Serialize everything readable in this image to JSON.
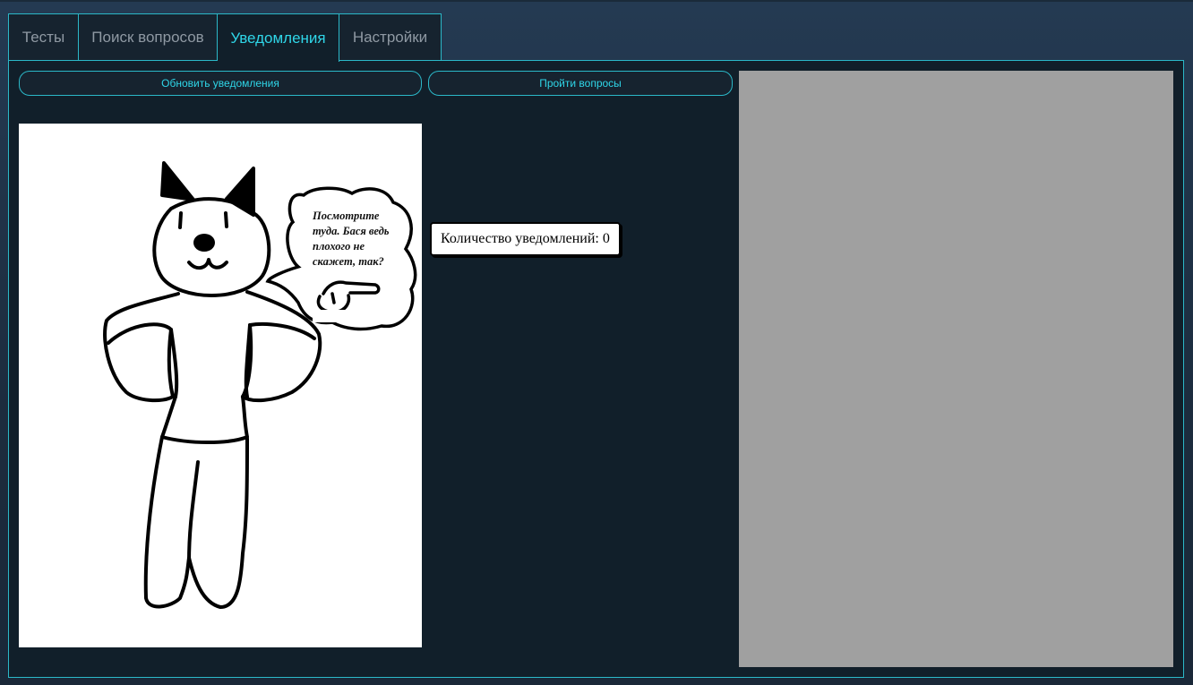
{
  "tabs": [
    {
      "label": "Тесты",
      "active": false
    },
    {
      "label": "Поиск вопросов",
      "active": false
    },
    {
      "label": "Уведомления",
      "active": true
    },
    {
      "label": "Настройки",
      "active": false
    }
  ],
  "toolbar": {
    "refresh_label": "Обновить уведомления",
    "go_questions_label": "Пройти вопросы"
  },
  "mascot": {
    "speech_lines": [
      "Посмотрите",
      "туда. Бася ведь",
      "плохого не",
      "скажет, так?"
    ]
  },
  "notifications": {
    "count_label": "Количество уведомлений: 0"
  },
  "colors": {
    "accent": "#2fd6e8",
    "border": "#2bb8c8",
    "panel_bg": "#111f2a",
    "placeholder_gray": "#a0a0a0"
  }
}
